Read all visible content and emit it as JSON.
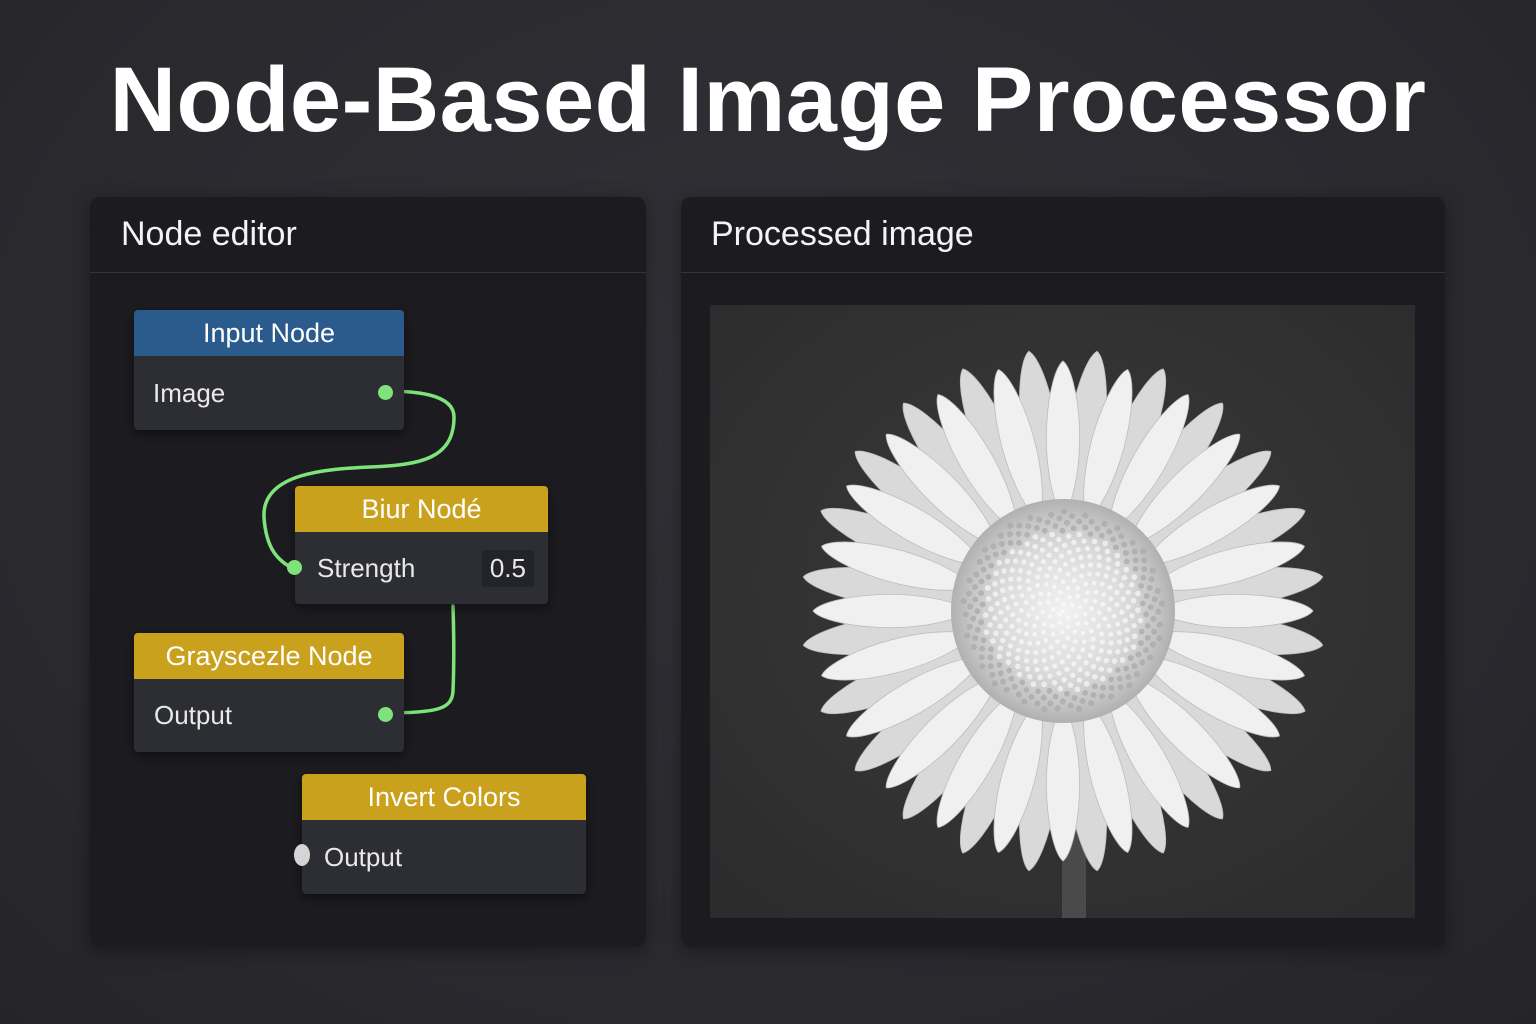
{
  "title": "Node-Based Image Processor",
  "editor": {
    "label": "Node editor",
    "nodes": [
      {
        "header": "Input Node",
        "row_label": "Image",
        "color": "#2b5a8c"
      },
      {
        "header": "Biur Nodé",
        "row_label": "Strength",
        "value": "0.5",
        "color": "#c9a11c"
      },
      {
        "header": "Grayscezle Node",
        "row_label": "Output",
        "color": "#c9a11c"
      },
      {
        "header": "Invert Colors",
        "row_label": "Output",
        "color": "#c9a11c"
      }
    ],
    "wire_color": "#7fe37c"
  },
  "viewer": {
    "label": "Processed image",
    "image_subject": "grayscale-sunflower"
  }
}
